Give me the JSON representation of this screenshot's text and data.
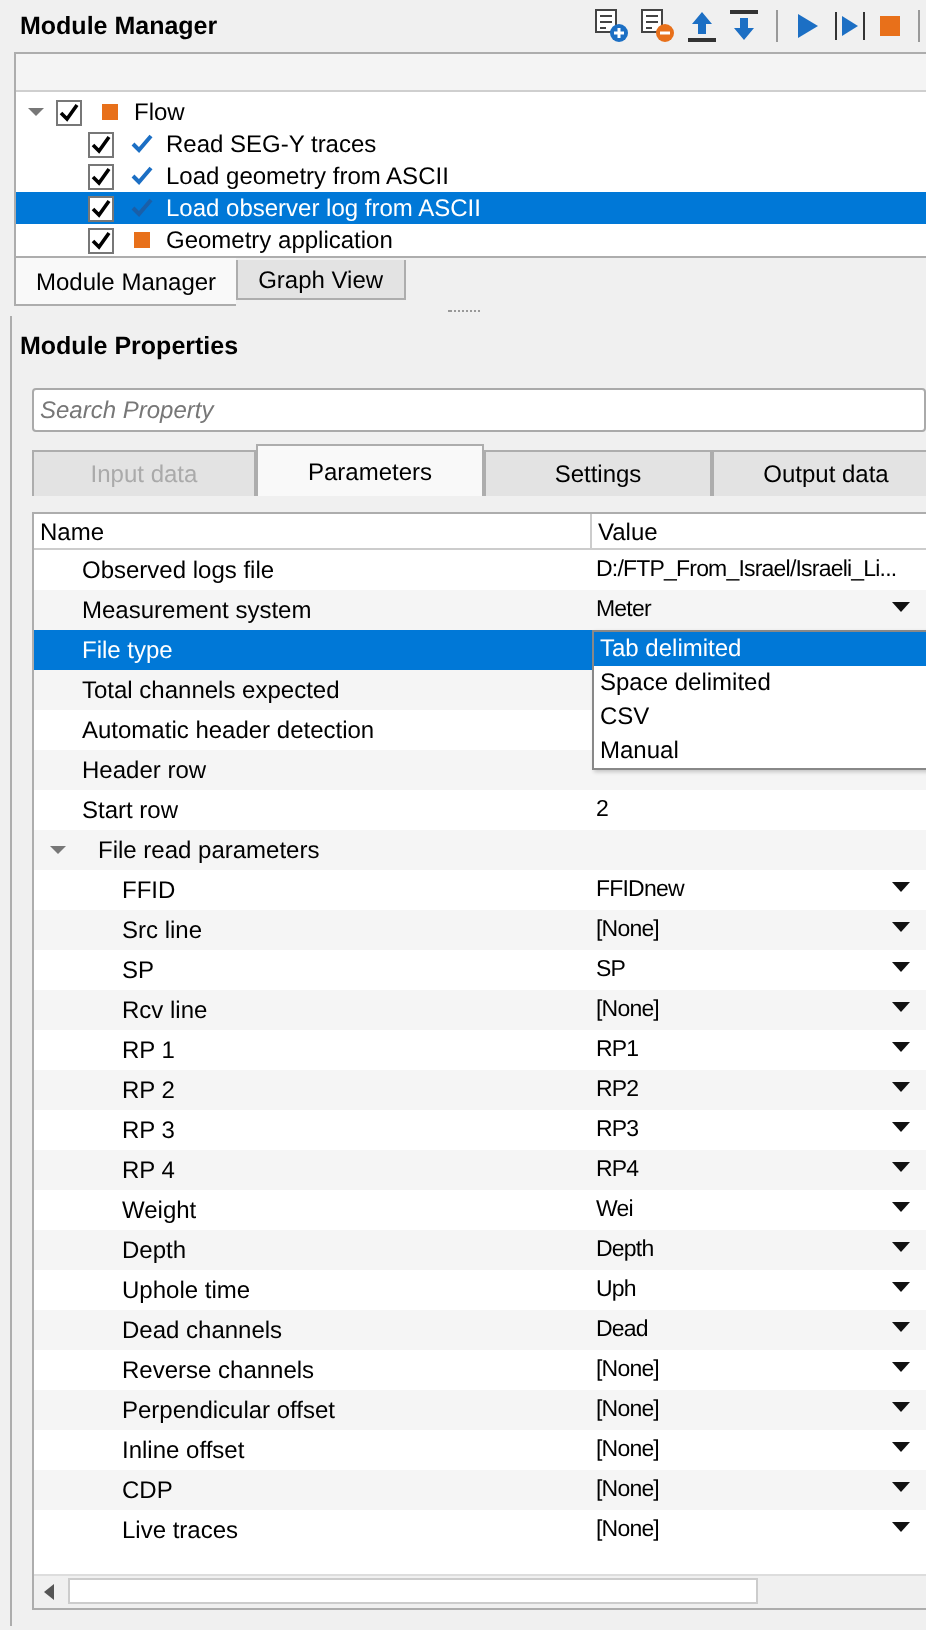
{
  "module_manager": {
    "title": "Module Manager",
    "toolbar": [
      {
        "kind": "add"
      },
      {
        "kind": "remove"
      },
      {
        "kind": "up"
      },
      {
        "kind": "down"
      },
      {
        "kind": "sep"
      },
      {
        "kind": "run"
      },
      {
        "kind": "step"
      },
      {
        "kind": "stop"
      },
      {
        "kind": "sep"
      }
    ],
    "tree": [
      {
        "label": "Flow",
        "checked": true,
        "kind": "pending",
        "expanded": true,
        "selected": false,
        "children": [
          {
            "label": "Read SEG-Y traces",
            "checked": true,
            "kind": "done",
            "selected": false
          },
          {
            "label": "Load geometry from ASCII",
            "checked": true,
            "kind": "done",
            "selected": false
          },
          {
            "label": "Load observer log from ASCII",
            "checked": true,
            "kind": "done",
            "selected": true
          },
          {
            "label": "Geometry application",
            "checked": true,
            "kind": "pending",
            "selected": false
          }
        ]
      }
    ],
    "tabs": [
      {
        "label": "Module Manager",
        "selected": true
      },
      {
        "label": "Graph View",
        "selected": false
      }
    ]
  },
  "module_properties": {
    "title": "Module Properties",
    "search": {
      "placeholder": "Search Property"
    },
    "tabs": [
      {
        "label": "Input data",
        "selected": false,
        "disabled": true
      },
      {
        "label": "Parameters",
        "selected": true,
        "disabled": false
      },
      {
        "label": "Settings",
        "selected": false,
        "disabled": false
      },
      {
        "label": "Output data",
        "selected": false,
        "disabled": false
      }
    ],
    "table": {
      "columns": [
        "Name",
        "Value"
      ],
      "rows": [
        {
          "name": "Observed logs file",
          "value": "D:/FTP_From_Israel/Israeli_Li...",
          "selected": false
        },
        {
          "name": "Measurement system",
          "value": "Meter",
          "dropdown": true,
          "selected": false
        },
        {
          "name": "File type",
          "selected": true,
          "popup": [
            {
              "label": "Tab delimited",
              "selected": true
            },
            {
              "label": "Space delimited",
              "selected": false
            },
            {
              "label": "CSV",
              "selected": false
            },
            {
              "label": "Manual",
              "selected": false
            }
          ]
        },
        {
          "name": "Total channels expected",
          "selected": false
        },
        {
          "name": "Automatic header detection",
          "selected": false
        },
        {
          "name": "Header row",
          "selected": false
        },
        {
          "name": "Start row",
          "value": "2",
          "selected": false
        },
        {
          "name": "File read parameters",
          "selected": false,
          "expanded": true,
          "children": [
            {
              "name": "FFID",
              "value": "FFIDnew",
              "dropdown": true,
              "selected": false
            },
            {
              "name": "Src line",
              "value": "[None]",
              "dropdown": true,
              "selected": false
            },
            {
              "name": "SP",
              "value": "SP",
              "dropdown": true,
              "selected": false
            },
            {
              "name": "Rcv line",
              "value": "[None]",
              "dropdown": true,
              "selected": false
            },
            {
              "name": "RP 1",
              "value": "RP1",
              "dropdown": true,
              "selected": false
            },
            {
              "name": "RP 2",
              "value": "RP2",
              "dropdown": true,
              "selected": false
            },
            {
              "name": "RP 3",
              "value": "RP3",
              "dropdown": true,
              "selected": false
            },
            {
              "name": "RP 4",
              "value": "RP4",
              "dropdown": true,
              "selected": false
            },
            {
              "name": "Weight",
              "value": "Wei",
              "dropdown": true,
              "selected": false
            },
            {
              "name": "Depth",
              "value": "Depth",
              "dropdown": true,
              "selected": false
            },
            {
              "name": "Uphole time",
              "value": "Uph",
              "dropdown": true,
              "selected": false
            },
            {
              "name": "Dead channels",
              "value": "Dead",
              "dropdown": true,
              "selected": false
            },
            {
              "name": "Reverse channels",
              "value": "[None]",
              "dropdown": true,
              "selected": false
            },
            {
              "name": "Perpendicular offset",
              "value": "[None]",
              "dropdown": true,
              "selected": false
            },
            {
              "name": "Inline offset",
              "value": "[None]",
              "dropdown": true,
              "selected": false
            },
            {
              "name": "CDP",
              "value": "[None]",
              "dropdown": true,
              "selected": false
            },
            {
              "name": "Live traces",
              "value": "[None]",
              "dropdown": true,
              "selected": false
            }
          ]
        }
      ]
    }
  }
}
